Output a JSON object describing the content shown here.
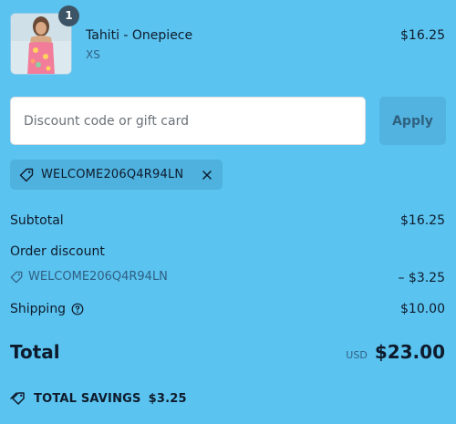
{
  "product": {
    "quantity": "1",
    "name": "Tahiti - Onepiece",
    "variant": "XS",
    "price": "$16.25",
    "image": "swimsuit-photo"
  },
  "discount": {
    "placeholder": "Discount code or gift card",
    "apply_label": "Apply",
    "applied_code": "WELCOME206Q4R94LN"
  },
  "summary": {
    "subtotal_label": "Subtotal",
    "subtotal_value": "$16.25",
    "order_discount_label": "Order discount",
    "discount_code": "WELCOME206Q4R94LN",
    "discount_value": "– $3.25",
    "shipping_label": "Shipping",
    "shipping_value": "$10.00",
    "total_label": "Total",
    "currency": "USD",
    "total_value": "$23.00",
    "savings_label": "TOTAL SAVINGS",
    "savings_value": "$3.25"
  },
  "colors": {
    "background": "#5bc3ef",
    "button": "#52b3e0",
    "badge": "#3d5466"
  }
}
